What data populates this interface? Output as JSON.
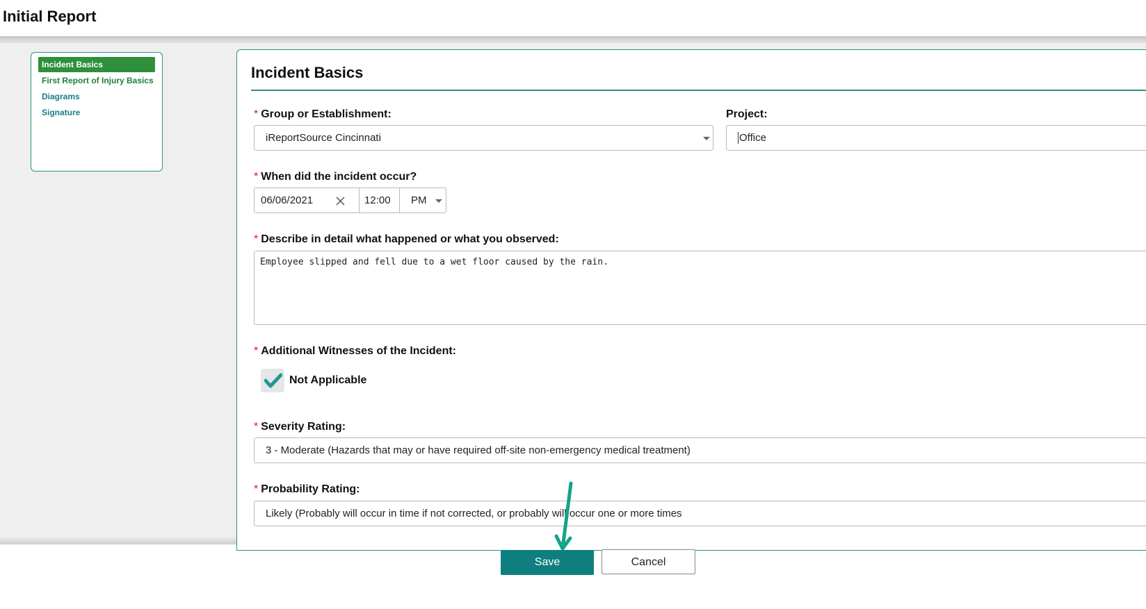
{
  "header": {
    "title": "Initial Report"
  },
  "nav": {
    "items": [
      {
        "label": "Incident Basics",
        "active": true
      },
      {
        "label": "First Report of Injury Basics",
        "active": false
      },
      {
        "label": "Diagrams",
        "active": false
      },
      {
        "label": "Signature",
        "active": false
      }
    ]
  },
  "panel": {
    "title": "Incident Basics"
  },
  "form": {
    "required_marker": "*",
    "group": {
      "label": "Group or Establishment:",
      "value": "iReportSource Cincinnati"
    },
    "project": {
      "label": "Project:",
      "value": "Office"
    },
    "when": {
      "label": "When did the incident occur?",
      "date": "06/06/2021",
      "time": "12:00",
      "ampm": "PM"
    },
    "describe": {
      "label": "Describe in detail what happened or what you observed:",
      "value": "Employee slipped and fell due to a wet floor caused by the rain."
    },
    "witnesses": {
      "label": "Additional Witnesses of the Incident:",
      "checkbox_label": "Not Applicable",
      "checked": true
    },
    "severity": {
      "label": "Severity Rating:",
      "value": "3 - Moderate (Hazards that may or have required off-site non-emergency medical treatment)"
    },
    "probability": {
      "label": "Probability Rating:",
      "value": "Likely (Probably will occur in time if not corrected, or probably will occur one or more times"
    }
  },
  "buttons": {
    "save": "Save",
    "cancel": "Cancel"
  },
  "colors": {
    "accent": "#0e7f7e",
    "nav_active": "#2f8f3c",
    "required": "#d32020",
    "arrow": "#14a38a"
  },
  "icons": {
    "clear": "close-icon",
    "dropdown": "chevron-down-icon",
    "check": "check-icon",
    "pointer": "arrow-icon"
  }
}
